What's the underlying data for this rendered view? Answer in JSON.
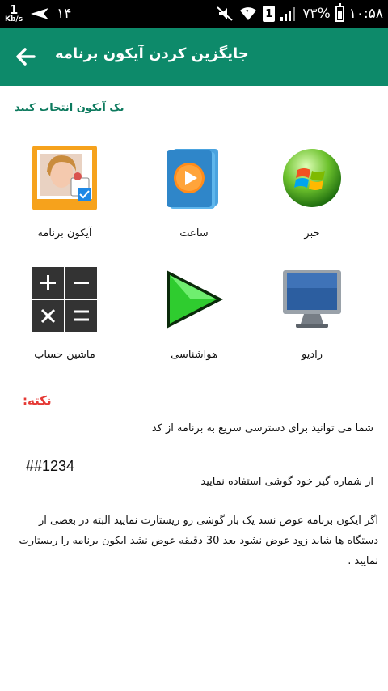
{
  "status_bar": {
    "speed_value": "1",
    "speed_unit": "Kb/s",
    "notification_count": "۱۴",
    "sim_label": "1",
    "battery_text": "۷۳%",
    "time": "۱۰:۵۸",
    "battery_level": 0.73
  },
  "app_bar": {
    "title": "جایگزین کردن آیکون برنامه",
    "color": "#0d8a6a"
  },
  "section_label": "یک آیکون انتخاب کنید",
  "icons": [
    {
      "label": "خبر",
      "icon": "windows-logo-icon"
    },
    {
      "label": "ساعت",
      "icon": "media-player-icon"
    },
    {
      "label": "آیکون برنامه",
      "icon": "app-photo-icon"
    },
    {
      "label": "رادیو",
      "icon": "monitor-icon"
    },
    {
      "label": "هواشناسی",
      "icon": "green-arrow-icon"
    },
    {
      "label": "ماشین حساب",
      "icon": "calculator-icon"
    }
  ],
  "note": {
    "title": "نکته:",
    "line1": "شما می توانید برای دسترسی سریع به برنامه از کد",
    "code": "##1234",
    "line2": "از شماره گیر خود گوشی استفاده نمایید",
    "paragraph": "اگر ایکون برنامه عوض نشد یک بار گوشی رو ریستارت نمایید البته در بعضی از دستگاه ها شاید زود عوض نشود بعد 30 دقیقه عوض نشد ایکون  برنامه را ریستارت نمایید ."
  }
}
